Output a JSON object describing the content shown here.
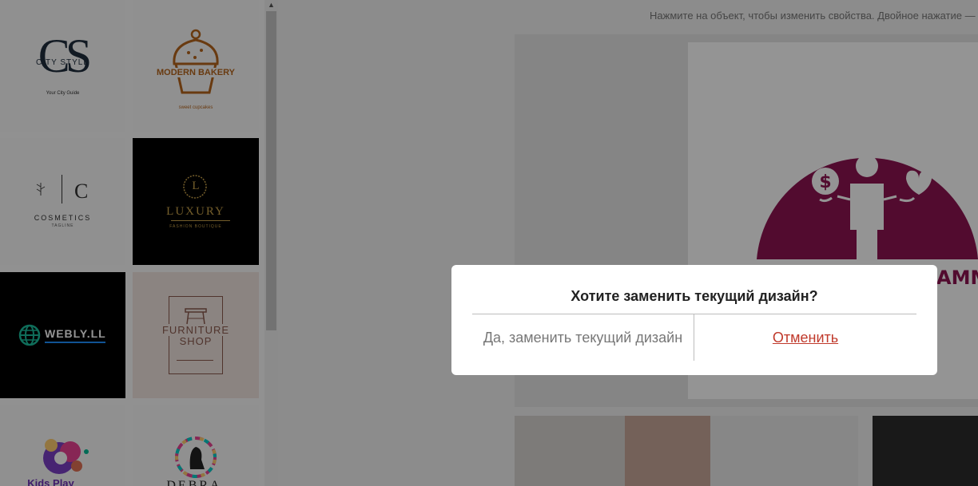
{
  "gallery": {
    "templates": [
      {
        "name": "CITY STYLE",
        "monogram": "CS",
        "tagline": "Your City Guide"
      },
      {
        "name": "MODERN BAKERY",
        "tagline": "sweet cupcakes"
      },
      {
        "name": "COSMETICS",
        "monogram": "C",
        "tagline": "TAGLINE"
      },
      {
        "name": "LUXURY",
        "monogram": "L",
        "tagline": "FASHION BOUTIQUE"
      },
      {
        "name": "WEBLY.LL"
      },
      {
        "name": "FURNITURE",
        "name2": "SHOP"
      },
      {
        "name": "Kids Play"
      },
      {
        "name": "DEBRA"
      }
    ],
    "scroll_up": "▲"
  },
  "canvas": {
    "hint": "Нажмите на объект, чтобы изменить свойства. Двойное нажатие — р",
    "preview_partial_text": "AMMI"
  },
  "dialog": {
    "title": "Хотите заменить текущий дизайн?",
    "confirm_label": "Да, заменить текущий дизайн",
    "cancel_label": "Отменить"
  },
  "colors": {
    "accent_magenta": "#8e1452",
    "cancel_red": "#c0392b",
    "bakery_orange": "#b5651d",
    "luxury_gold": "#c9a24a"
  }
}
